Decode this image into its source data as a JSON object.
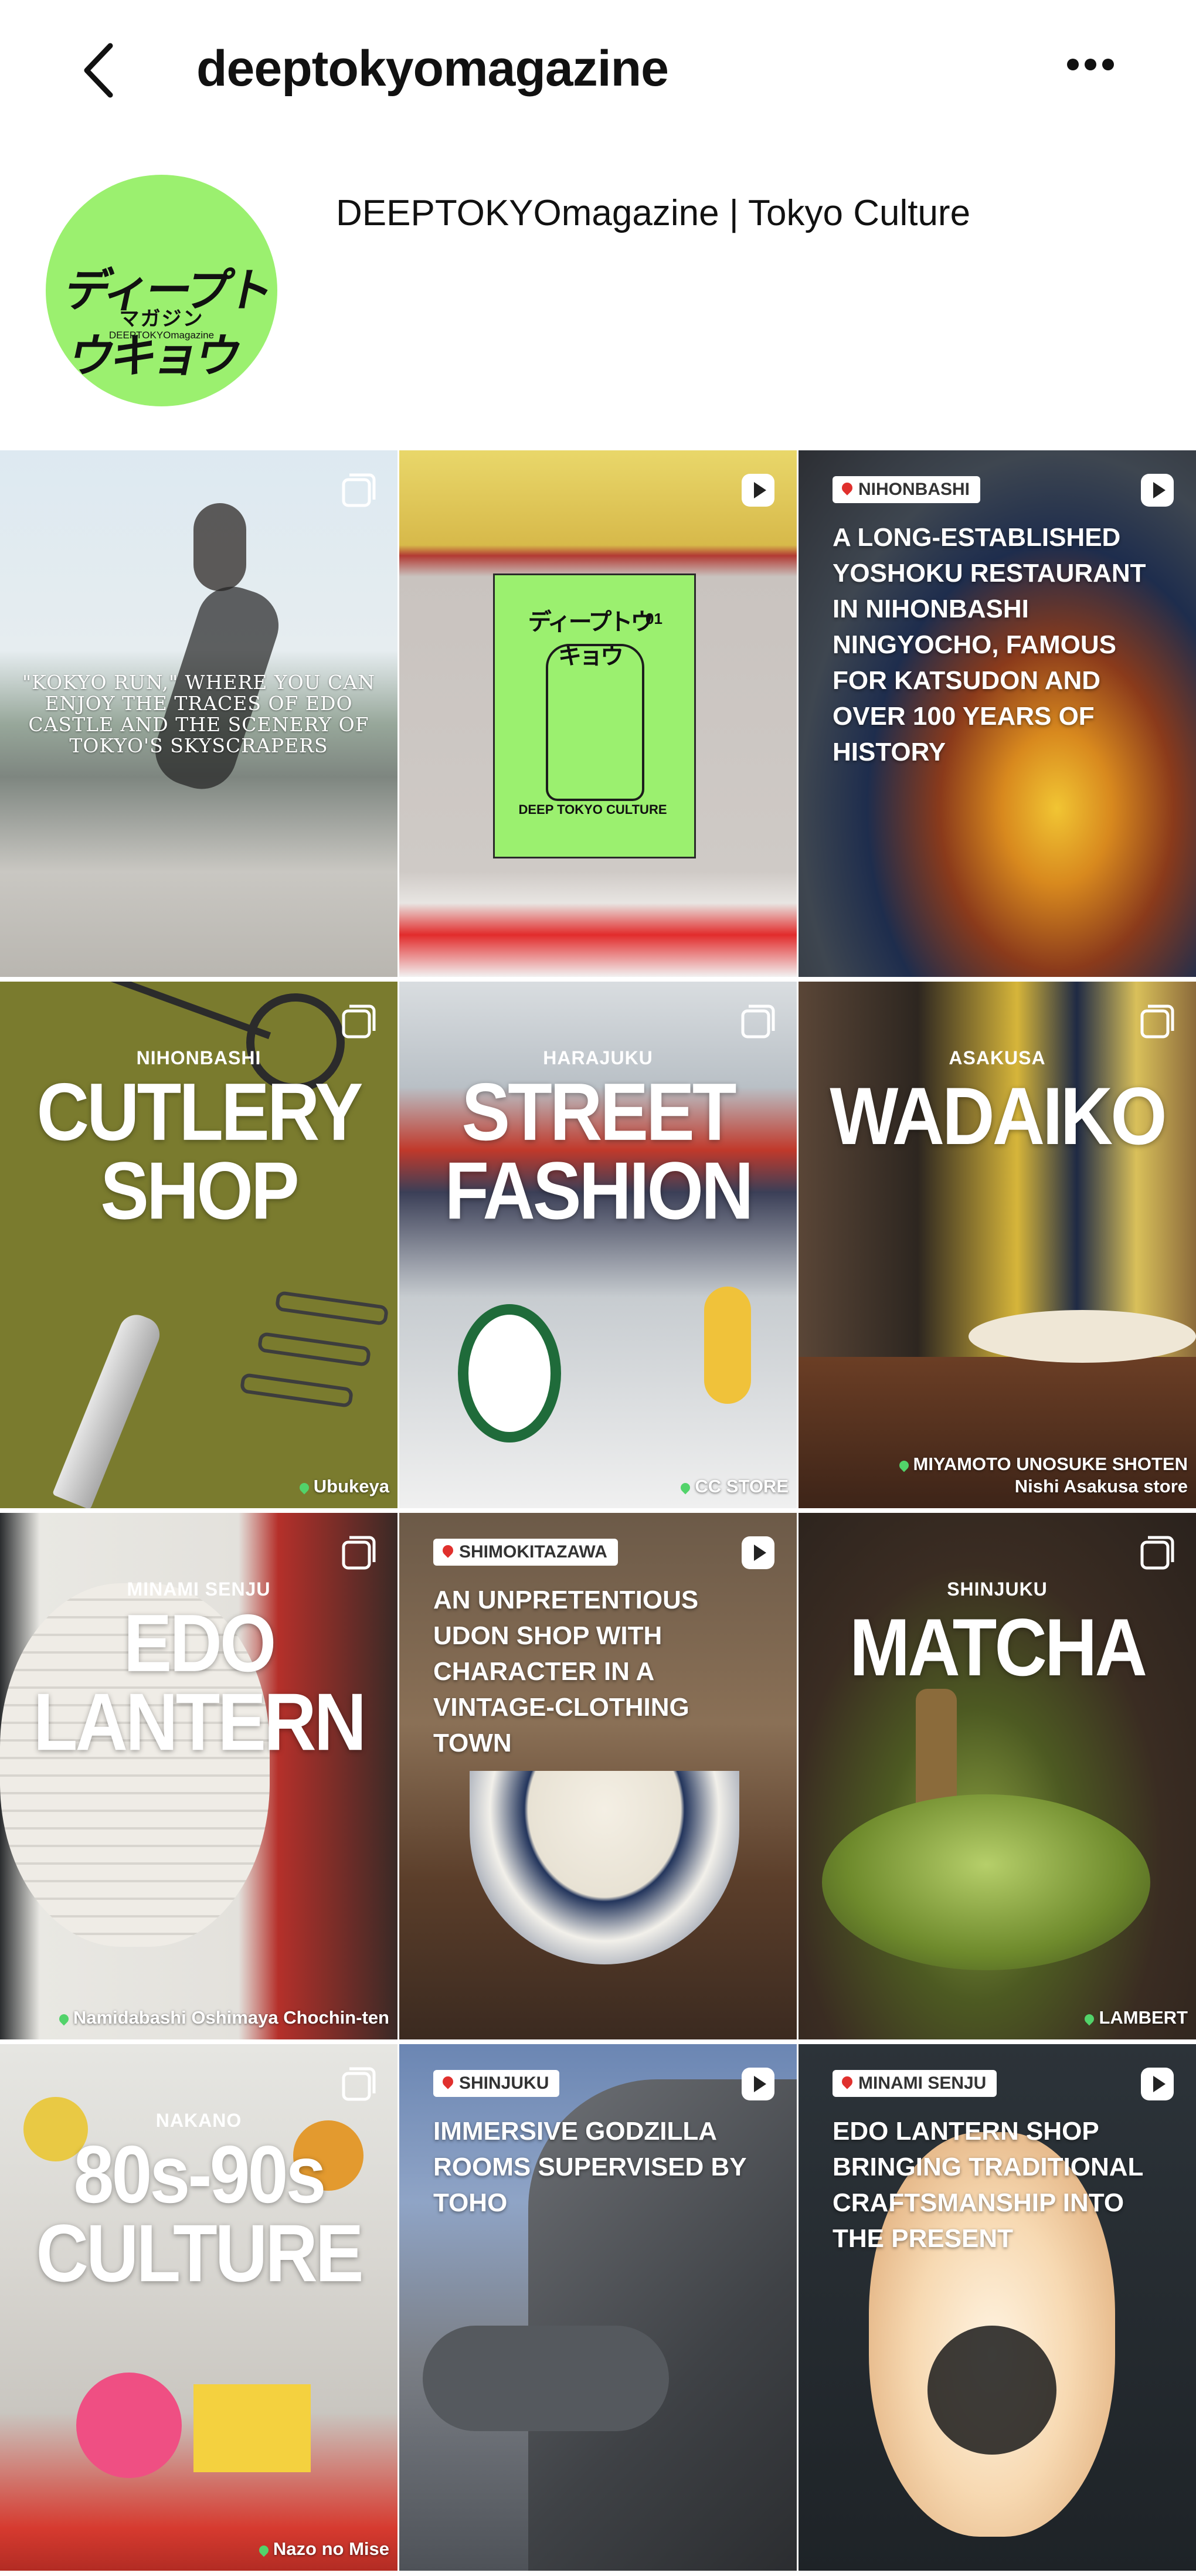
{
  "header": {
    "handle": "deeptokyomagazine",
    "back_icon": "chevron-left-icon",
    "more_icon": "more-horizontal-icon"
  },
  "profile": {
    "name": "DEEPTOKYOmagazine | Tokyo Culture",
    "avatar_logo_main": "ディープトウキョウ",
    "avatar_logo_sub": "マガジン",
    "avatar_logo_small": "DEEPTOKYOmagazine",
    "avatar_color": "#9bf06f"
  },
  "posts": [
    {
      "type": "carousel",
      "caption": "\"KOKYO RUN,\" WHERE YOU CAN ENJOY THE TRACES OF EDO CASTLE AND THE SCENERY OF TOKYO'S SKYSCRAPERS"
    },
    {
      "type": "reel",
      "magazine_title": "DEEP TOKYO CULTURE",
      "magazine_issue": "01"
    },
    {
      "type": "reel",
      "tag": "NIHONBASHI",
      "caption": "A LONG-ESTABLISHED YOSHOKU RESTAURANT IN NIHONBASHI NINGYOCHO, FAMOUS FOR KATSUDON AND OVER 100 YEARS OF HISTORY"
    },
    {
      "type": "carousel",
      "location": "NIHONBASHI",
      "title": "CUTLERY SHOP",
      "credit": "Ubukeya"
    },
    {
      "type": "carousel",
      "location": "HARAJUKU",
      "title": "STREET FASHION",
      "credit": "CC STORE"
    },
    {
      "type": "carousel",
      "location": "ASAKUSA",
      "title": "WADAIKO",
      "credit": "MIYAMOTO UNOSUKE SHOTEN",
      "credit2": "Nishi Asakusa store"
    },
    {
      "type": "carousel",
      "location": "MINAMI SENJU",
      "title": "EDO LANTERN",
      "credit": "Namidabashi Oshimaya Chochin-ten"
    },
    {
      "type": "reel",
      "tag": "SHIMOKITAZAWA",
      "caption": "AN UNPRETENTIOUS UDON SHOP WITH CHARACTER IN A VINTAGE-CLOTHING TOWN"
    },
    {
      "type": "carousel",
      "location": "SHINJUKU",
      "title": "MATCHA",
      "credit": "LAMBERT"
    },
    {
      "type": "carousel",
      "location": "NAKANO",
      "title": "80s-90s CULTURE",
      "credit": "Nazo no Mise"
    },
    {
      "type": "reel",
      "tag": "SHINJUKU",
      "caption": "IMMERSIVE GODZILLA ROOMS SUPERVISED BY TOHO"
    },
    {
      "type": "reel",
      "tag": "MINAMI SENJU",
      "caption": "EDO LANTERN SHOP BRINGING TRADITIONAL CRAFTSMANSHIP INTO THE PRESENT"
    }
  ],
  "colors": {
    "pin_red": "#e0302d",
    "pin_green": "#52d36a",
    "olive": "#7a7b2e"
  }
}
